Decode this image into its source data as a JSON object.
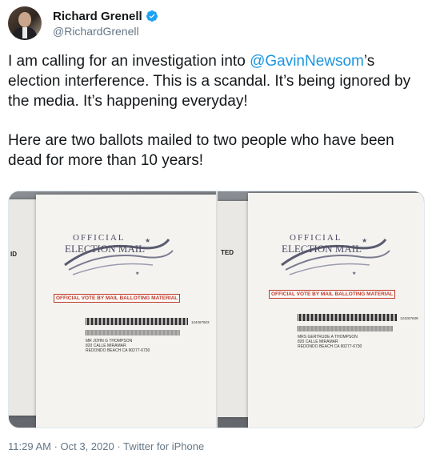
{
  "author": {
    "display_name": "Richard Grenell",
    "handle": "@RichardGrenell",
    "verified": true,
    "avatar_icon": "profile-photo"
  },
  "tweet": {
    "line1_prefix": "I am calling for an investigation into ",
    "mention": "@GavinNewsom",
    "line1_suffix": "’s election interference. This is a scandal. It’s being ignored by the media. It’s happening everyday!",
    "paragraph2": "Here are two ballots mailed to two people who have been dead for more than 10 years!"
  },
  "media": [
    {
      "edge_text": "ID",
      "logo_line1": "OFFICIAL",
      "logo_line2": "ELECTION MAIL",
      "banner": "OFFICIAL VOTE BY MAIL BALLOTING MATERIAL",
      "barcode_number": "124267603",
      "address": [
        "MR JOHN G THOMPSON",
        "820 CALLE MIRAMAR",
        "REDONDO BEACH CA 90277-6730"
      ]
    },
    {
      "edge_text": "TED",
      "logo_line1": "OFFICIAL",
      "logo_line2": "ELECTION MAIL",
      "banner": "OFFICIAL VOTE BY MAIL BALLOTING MATERIAL",
      "barcode_number": "124267639",
      "address": [
        "MRS GERTRUDE A THOMPSON",
        "820 CALLE MIRAMAR",
        "REDONDO BEACH CA 90277-6730"
      ]
    }
  ],
  "footer": {
    "timestamp": "11:29 AM · Oct 3, 2020 · Twitter for iPhone"
  },
  "colors": {
    "link": "#1b95e0",
    "text": "#14171a",
    "muted": "#657786",
    "verified": "#1da1f2",
    "ballot_red": "#c0392b"
  }
}
